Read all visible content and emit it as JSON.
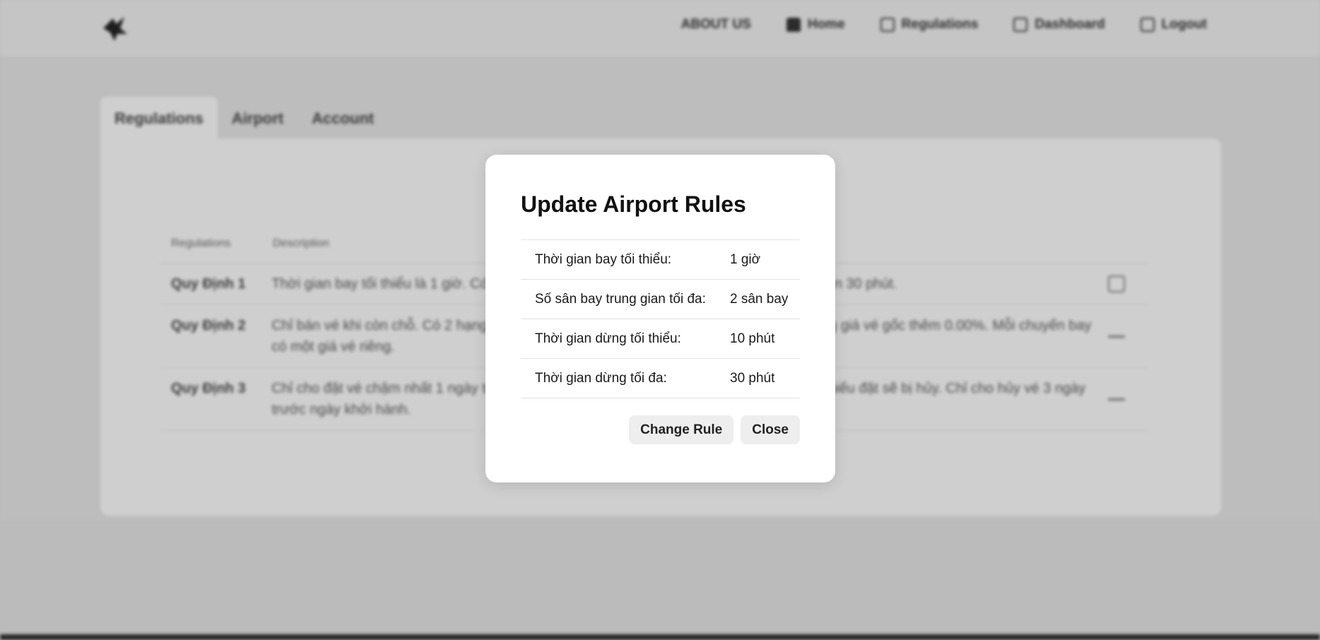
{
  "nav": {
    "items": [
      {
        "label": "ABOUT US",
        "icon": ""
      },
      {
        "label": "Home",
        "icon": "home-icon"
      },
      {
        "label": "Regulations",
        "icon": "list-icon"
      },
      {
        "label": "Dashboard",
        "icon": "clipboard-icon"
      },
      {
        "label": "Logout",
        "icon": "logout-icon"
      }
    ]
  },
  "tabs": [
    {
      "label": "Regulations",
      "active": true
    },
    {
      "label": "Airport",
      "active": false
    },
    {
      "label": "Account",
      "active": false
    }
  ],
  "table": {
    "headers": [
      "Regulations",
      "Description"
    ],
    "rows": [
      {
        "name": "Quy Định 1",
        "description": "Thời gian bay tối thiểu là 1 giờ. Có tối đa 2 sân bay trung gian với thời gian dừng từ 10 đến 30 phút."
      },
      {
        "name": "Quy Định 2",
        "description": "Chỉ bán vé khi còn chỗ. Có 2 hạng vé (1, 2). Vé hạng 1 bằng 105% của đơn giá, LV2 bằng giá vé gốc thêm 0.00%. Mỗi chuyến bay có một giá vé riêng."
      },
      {
        "name": "Quy Định 3",
        "description": "Chỉ cho đặt vé chậm nhất 1 ngày trước ngày khởi hành. Vào ngày khởi hành tất cả các phiếu đặt sẽ bị hủy. Chỉ cho hủy vé 3 ngày trước ngày khởi hành."
      }
    ]
  },
  "modal": {
    "title": "Update Airport Rules",
    "rules": [
      {
        "label": "Thời gian bay tối thiểu:",
        "value": "1 giờ"
      },
      {
        "label": "Số sân bay trung gian tối đa:",
        "value": "2 sân bay"
      },
      {
        "label": "Thời gian dừng tối thiểu:",
        "value": "10 phút"
      },
      {
        "label": "Thời gian dừng tối đa:",
        "value": "30 phút"
      }
    ],
    "change_label": "Change Rule",
    "close_label": "Close"
  },
  "colors": {
    "modal_bg": "#ffffff",
    "button_bg": "#eeeeee",
    "backdrop": "#dadada"
  }
}
